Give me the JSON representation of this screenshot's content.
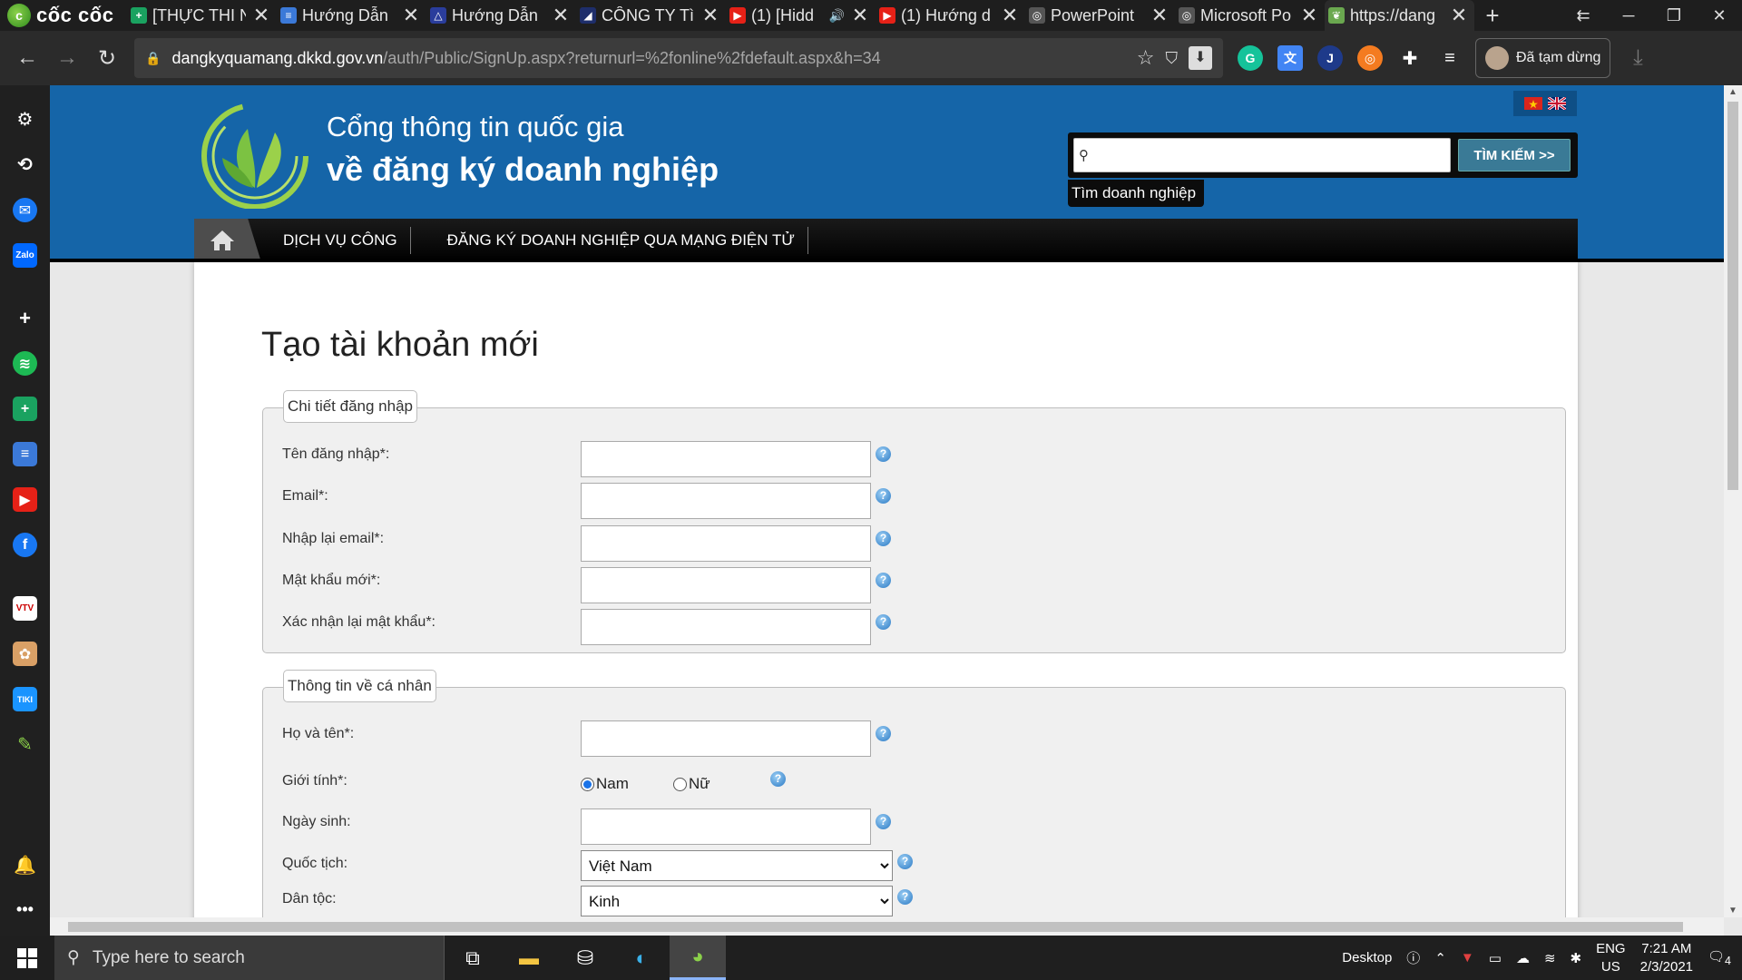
{
  "browser": {
    "brand": "cốc cốc",
    "tabs": [
      {
        "title": "[THỰC THI N",
        "favicon_color": "#1aa260",
        "favicon": "+"
      },
      {
        "title": "Hướng Dẫn",
        "favicon_color": "#3b79d8",
        "favicon": "≡"
      },
      {
        "title": "Hướng Dẫn",
        "favicon_color": "#2a3d9c",
        "favicon": "△"
      },
      {
        "title": "CÔNG TY Tì",
        "favicon_color": "#1e2e6b",
        "favicon": "◢"
      },
      {
        "title": "(1) [Hidd",
        "favicon_color": "#e62117",
        "favicon": "▶"
      },
      {
        "title": "(1) Hướng d",
        "favicon_color": "#e62117",
        "favicon": "▶"
      },
      {
        "title": "PowerPoint",
        "favicon_color": "#555555",
        "favicon": "◎"
      },
      {
        "title": "Microsoft Po",
        "favicon_color": "#555555",
        "favicon": "◎"
      },
      {
        "title": "https://dang",
        "favicon_color": "#6aa84f",
        "favicon": "❦"
      }
    ],
    "new_tab": "+",
    "address": {
      "host": "dangkyquamang.dkkd.gov.vn",
      "path": "/auth/Public/SignUp.aspx?returnurl=%2fonline%2fdefault.aspx&h=34"
    },
    "profile_label": "Đã tạm dừng"
  },
  "site": {
    "title_line1": "Cổng thông tin quốc gia",
    "title_line2": "về đăng ký doanh nghiệp",
    "search_placeholder": "",
    "search_button": "TÌM KIẾM >>",
    "search_tip": "Tìm doanh nghiệp",
    "nav": [
      "DỊCH VỤ CÔNG",
      "ĐĂNG KÝ DOANH NGHIỆP QUA MẠNG ĐIỆN TỬ"
    ]
  },
  "form": {
    "heading": "Tạo tài khoản mới",
    "login_section": {
      "legend": "Chi tiết đăng nhập",
      "fields": [
        {
          "label": "Tên đăng nhập*:",
          "value": ""
        },
        {
          "label": "Email*:",
          "value": ""
        },
        {
          "label": "Nhập lại email*:",
          "value": ""
        },
        {
          "label": "Mật khẩu mới*:",
          "value": ""
        },
        {
          "label": "Xác nhận lại mật khẩu*:",
          "value": ""
        }
      ]
    },
    "personal_section": {
      "legend": "Thông tin về cá nhân",
      "full_name_label": "Họ và tên*:",
      "gender_label": "Giới tính*:",
      "gender_options": [
        "Nam",
        "Nữ"
      ],
      "gender_selected": "Nam",
      "dob_label": "Ngày sinh:",
      "nationality_label": "Quốc tịch:",
      "nationality_value": "Việt Nam",
      "ethnicity_label": "Dân tộc:",
      "ethnicity_value": "Kinh"
    },
    "help_glyph": "?"
  },
  "taskbar": {
    "search_placeholder": "Type here to search",
    "desktop_label": "Desktop",
    "lang_top": "ENG",
    "lang_bottom": "US",
    "time": "7:21 AM",
    "date": "2/3/2021",
    "notifications": "4"
  },
  "colors": {
    "header_blue": "#1565a8",
    "search_button": "#3a7a96",
    "tab_bar": "#1e1e1e"
  }
}
